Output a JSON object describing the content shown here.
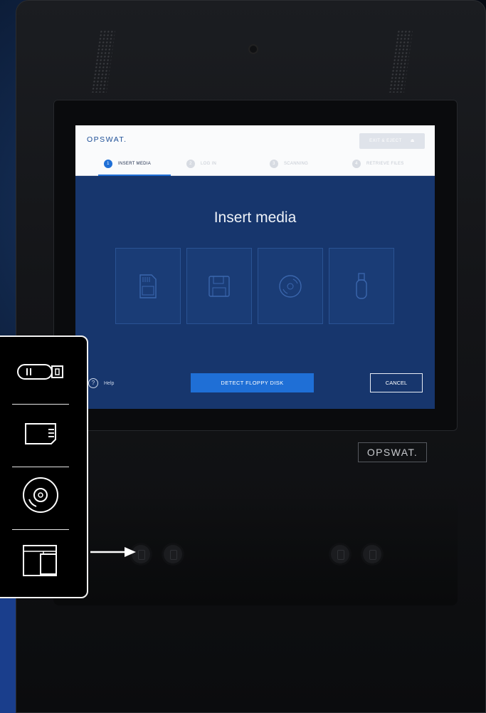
{
  "kiosk_screen": {
    "logo": "OPSWAT.",
    "exit_button": "EXIT & EJECT",
    "steps": [
      {
        "number": "1",
        "label": "INSERT MEDIA",
        "active": true
      },
      {
        "number": "2",
        "label": "LOG IN",
        "active": false
      },
      {
        "number": "3",
        "label": "SCANNING",
        "active": false
      },
      {
        "number": "4",
        "label": "RETRIEVE FILES",
        "active": false
      }
    ],
    "title": "Insert media",
    "media_options": [
      "sd-card-icon",
      "floppy-disk-icon",
      "cd-disc-icon",
      "usb-drive-icon"
    ],
    "help_label": "Help",
    "detect_button": "DETECT FLOPPY DISK",
    "cancel_button": "CANCEL"
  },
  "hardware": {
    "brand_plate": "OPSWAT."
  },
  "callout_panel": {
    "icons": [
      "usb-drive-icon",
      "sd-card-icon",
      "cd-disc-icon",
      "card-reader-icon"
    ]
  },
  "colors": {
    "screen_blue": "#17366d",
    "accent_blue": "#1f6fd6",
    "logo_blue": "#1d4f97"
  }
}
